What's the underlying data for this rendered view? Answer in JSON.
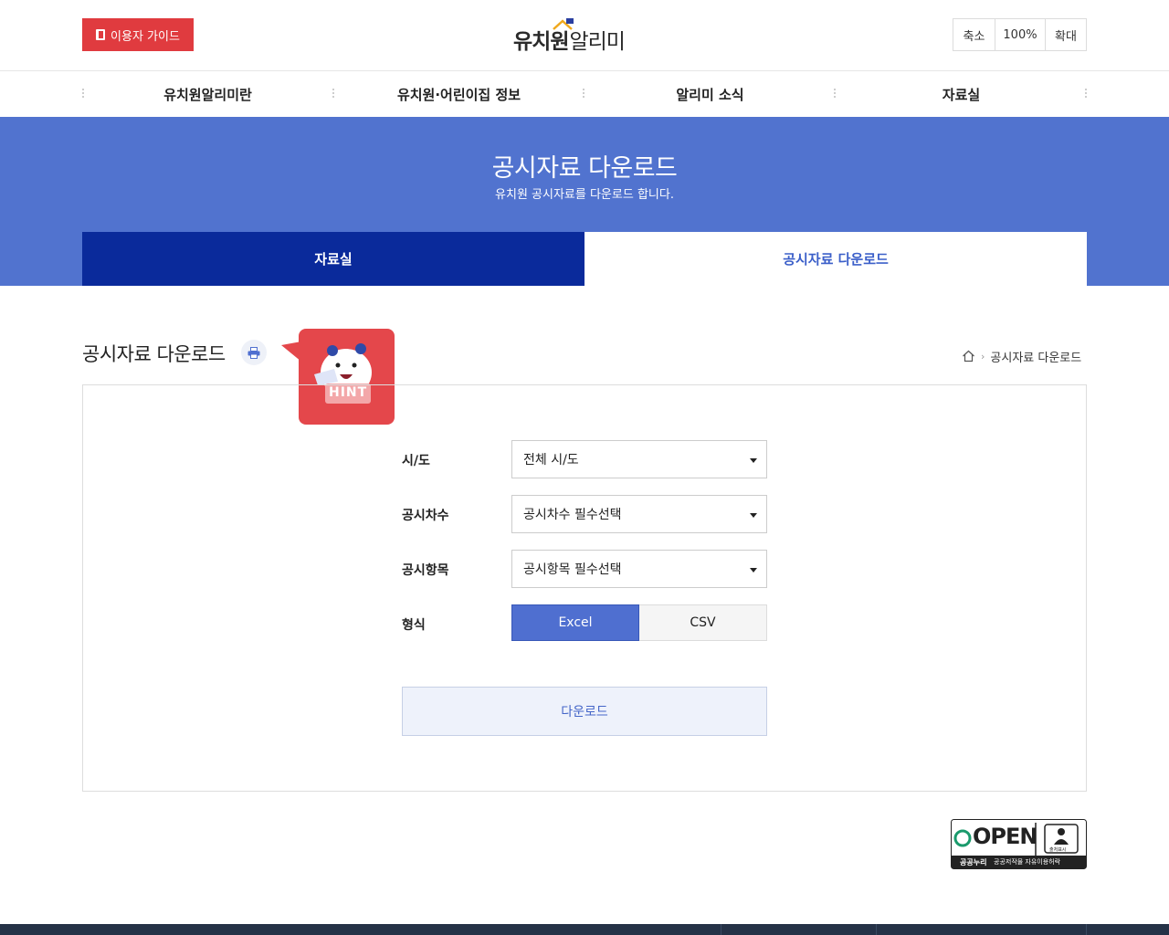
{
  "header": {
    "guide_button": "이용자 가이드",
    "logo_bold": "유치원",
    "logo_light": "알리미",
    "zoom_out": "축소",
    "zoom_level": "100%",
    "zoom_in": "확대"
  },
  "gnb": {
    "items": [
      "유치원알리미란",
      "유치원·어린이집 정보",
      "알리미 소식",
      "자료실"
    ]
  },
  "banner": {
    "title": "공시자료 다운로드",
    "subtitle": "유치원 공시자료를 다운로드 합니다.",
    "tabs": [
      "자료실",
      "공시자료 다운로드"
    ]
  },
  "content": {
    "title": "공시자료 다운로드",
    "hint_label": "HINT",
    "breadcrumb_current": "공시자료 다운로드"
  },
  "form": {
    "rows": [
      {
        "label": "시/도",
        "value": "전체 시/도"
      },
      {
        "label": "공시차수",
        "value": "공시차수 필수선택"
      },
      {
        "label": "공시항목",
        "value": "공시항목 필수선택"
      }
    ],
    "format_label": "형식",
    "format_options": [
      "Excel",
      "CSV"
    ],
    "format_selected": "Excel",
    "download_button": "다운로드"
  },
  "badge": {
    "open_text": "OPEN",
    "sub1": "공공누리",
    "sub2": "공공저작물 자유이용허락",
    "mark_label": "출처표시"
  },
  "colors": {
    "accent_red": "#e03b3f",
    "banner_blue": "#5173cf",
    "tab_active_navy": "#0a2a9b",
    "primary_blue": "#4f6fd0"
  }
}
